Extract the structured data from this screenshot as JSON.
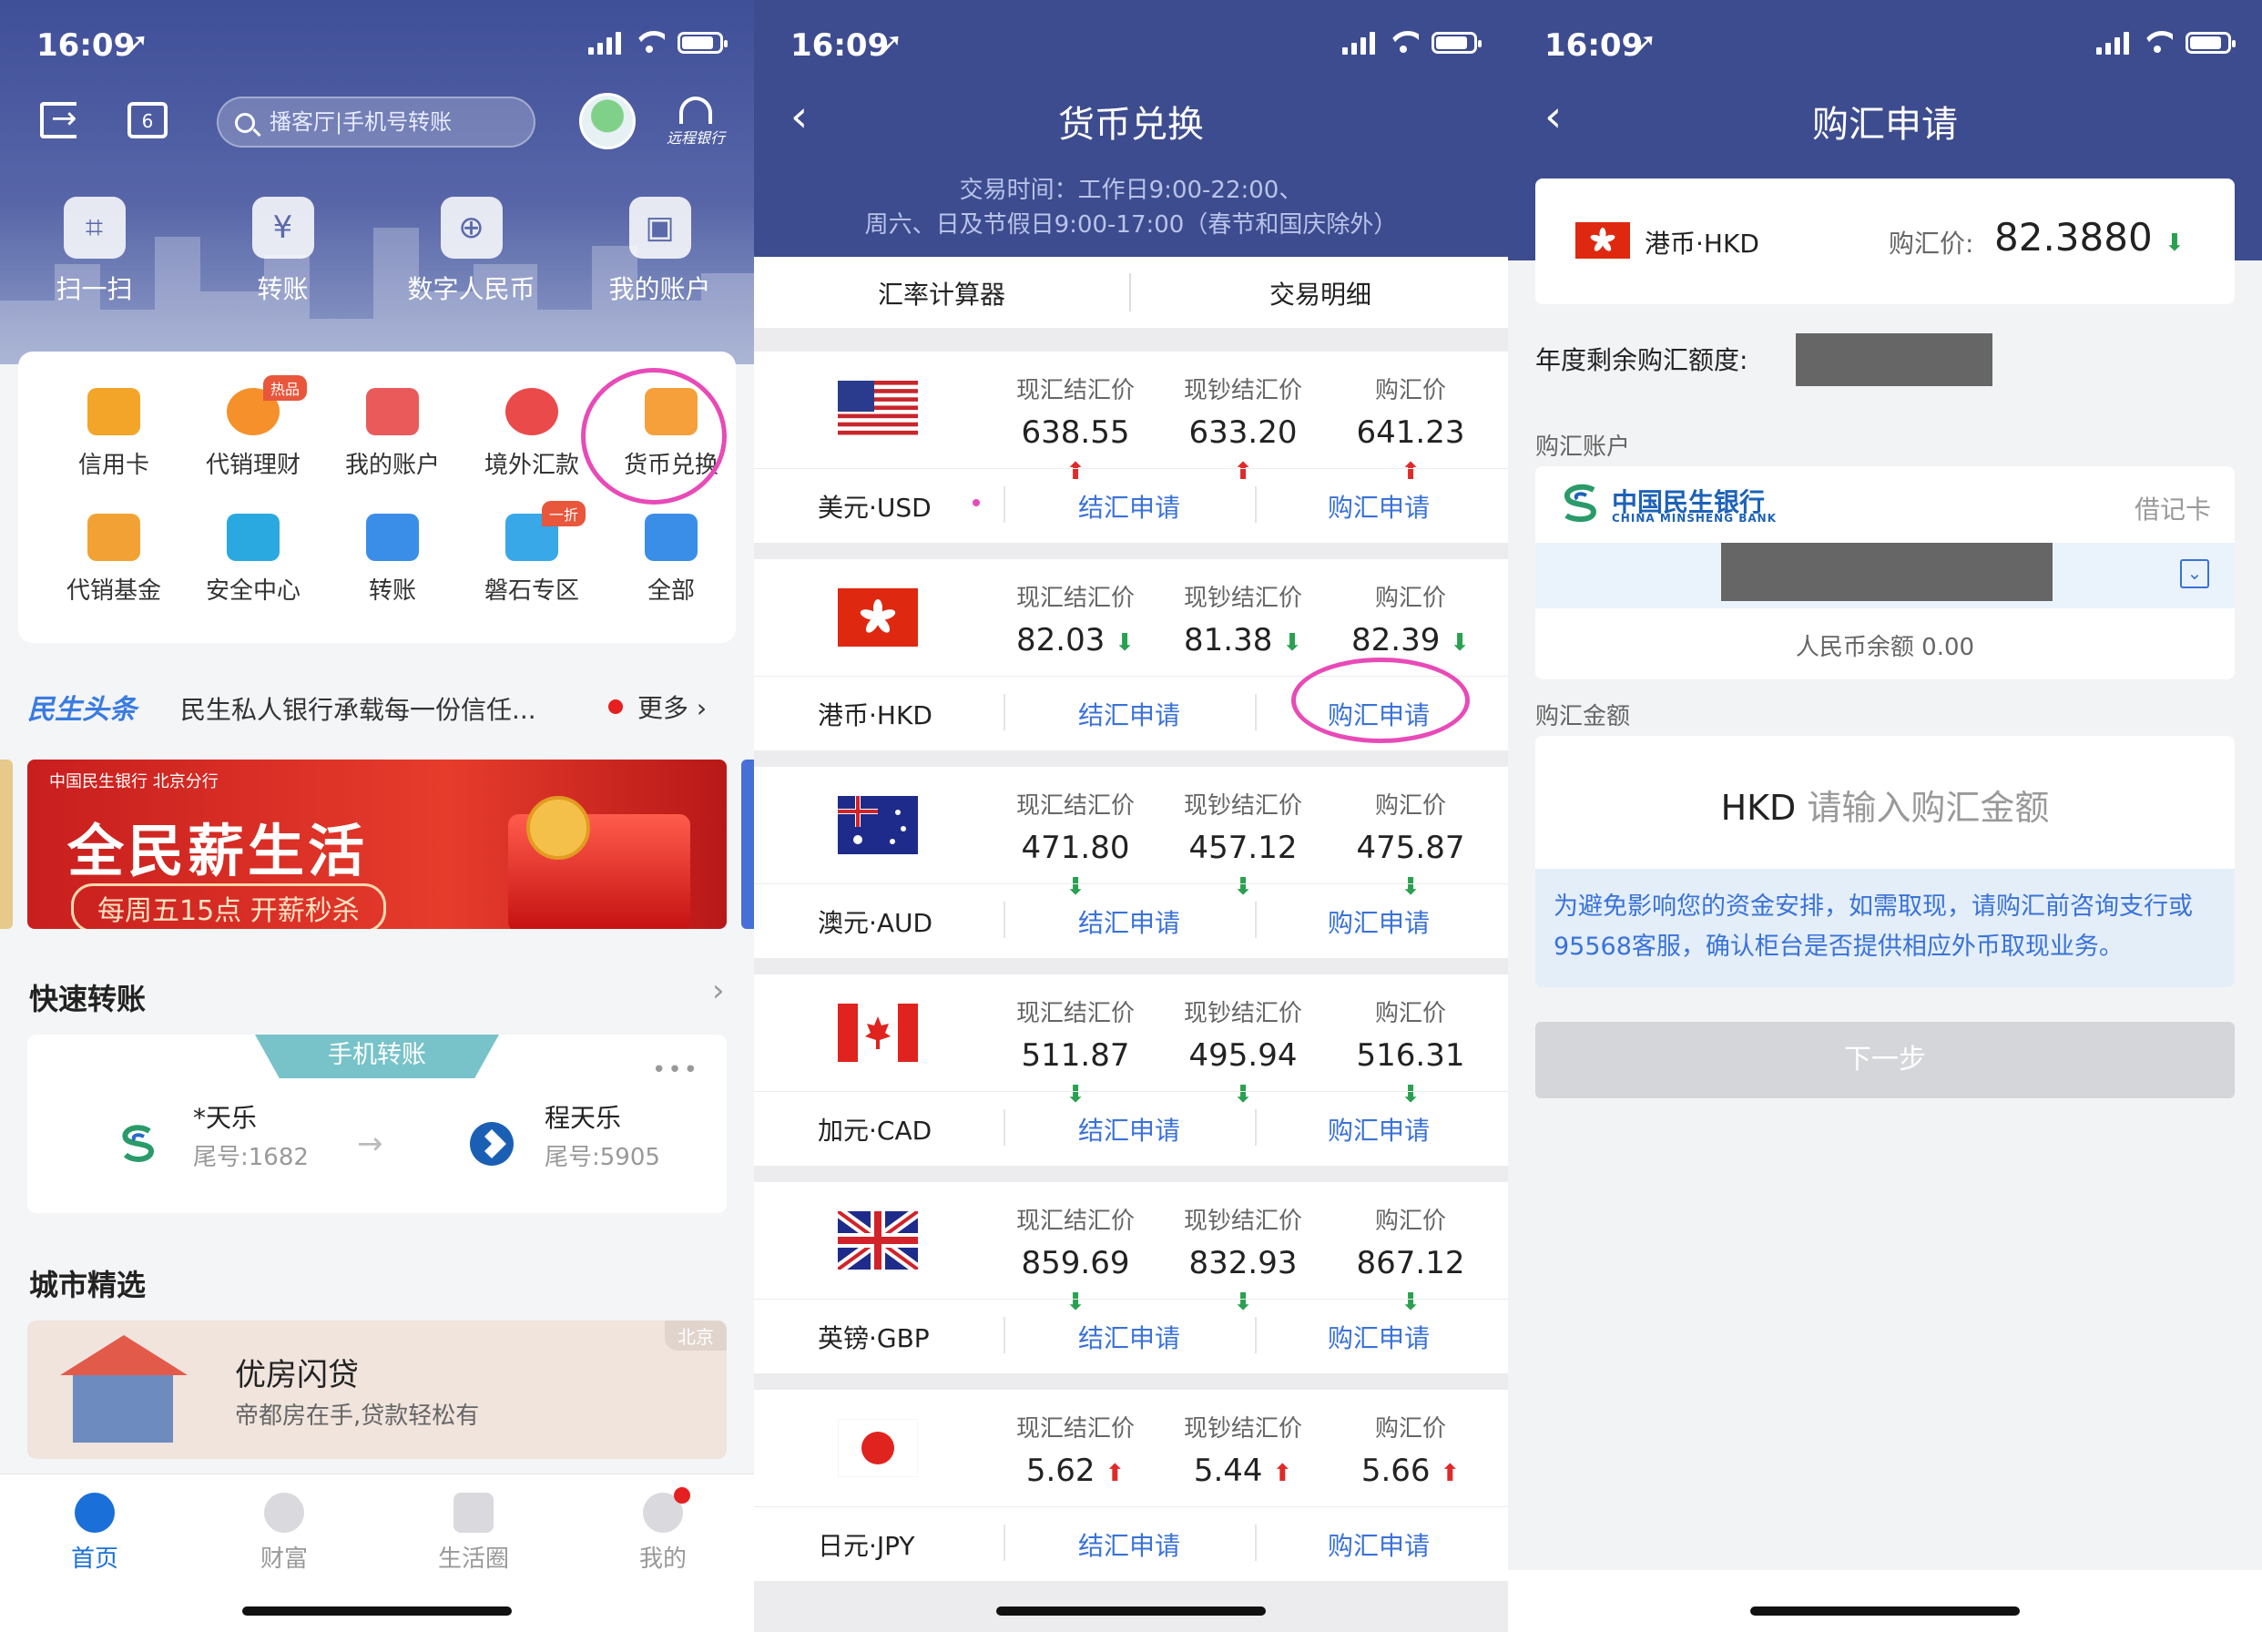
{
  "status": {
    "time": "16:09",
    "location_glyph": "➚"
  },
  "home": {
    "search_placeholder": "播客厅|手机号转账",
    "calendar_day": "6",
    "remote_label": "远程银行",
    "quick_actions": [
      "扫一扫",
      "转账",
      "数字人民币",
      "我的账户"
    ],
    "grid": [
      {
        "label": "信用卡",
        "tag": ""
      },
      {
        "label": "代销理财",
        "tag": "热品"
      },
      {
        "label": "我的账户",
        "tag": ""
      },
      {
        "label": "境外汇款",
        "tag": ""
      },
      {
        "label": "货币兑换",
        "tag": ""
      },
      {
        "label": "代销基金",
        "tag": ""
      },
      {
        "label": "安全中心",
        "tag": ""
      },
      {
        "label": "转账",
        "tag": ""
      },
      {
        "label": "磐石专区",
        "tag": "一折"
      },
      {
        "label": "全部",
        "tag": ""
      }
    ],
    "news": {
      "brand": "民生头条",
      "text": "民生私人银行承载每一份信任...",
      "more": "更多"
    },
    "banner": {
      "bank": "中国民生银行 北京分行",
      "headline": "全民薪生活",
      "sub": "每周五15点 开薪秒杀"
    },
    "quick_transfer": {
      "title": "快速转账",
      "ribbon": "手机转账",
      "from_name": "*天乐",
      "from_tail": "尾号:1682",
      "to_name": "程天乐",
      "to_tail": "尾号:5905"
    },
    "city": {
      "title": "城市精选",
      "loan_title": "优房闪贷",
      "loan_sub": "帝都房在手,贷款轻松有",
      "city_tag": "北京"
    },
    "tabs": [
      "首页",
      "财富",
      "生活圈",
      "我的"
    ]
  },
  "exchange": {
    "title": "货币兑换",
    "hours_line1": "交易时间：工作日9:00-22:00、",
    "hours_line2": "周六、日及节假日9:00-17:00（春节和国庆除外）",
    "subtabs": [
      "汇率计算器",
      "交易明细"
    ],
    "col_labels": [
      "现汇结汇价",
      "现钞结汇价",
      "购汇价"
    ],
    "sell_btn": "结汇申请",
    "buy_btn": "购汇申请",
    "rates": [
      {
        "name": "美元·USD",
        "flag": "us",
        "v1": "638.55",
        "d1": "up",
        "v2": "633.20",
        "d2": "up",
        "v3": "641.23",
        "d3": "up"
      },
      {
        "name": "港币·HKD",
        "flag": "hk",
        "v1": "82.03",
        "d1": "down",
        "v2": "81.38",
        "d2": "down",
        "v3": "82.39",
        "d3": "down"
      },
      {
        "name": "澳元·AUD",
        "flag": "au",
        "v1": "471.80",
        "d1": "down",
        "v2": "457.12",
        "d2": "down",
        "v3": "475.87",
        "d3": "down"
      },
      {
        "name": "加元·CAD",
        "flag": "ca",
        "v1": "511.87",
        "d1": "down",
        "v2": "495.94",
        "d2": "down",
        "v3": "516.31",
        "d3": "down"
      },
      {
        "name": "英镑·GBP",
        "flag": "gb",
        "v1": "859.69",
        "d1": "down",
        "v2": "832.93",
        "d2": "down",
        "v3": "867.12",
        "d3": "down"
      },
      {
        "name": "日元·JPY",
        "flag": "jp",
        "v1": "5.62",
        "d1": "up",
        "v2": "5.44",
        "d2": "up",
        "v3": "5.66",
        "d3": "up"
      }
    ]
  },
  "purchase": {
    "title": "购汇申请",
    "currency": "港币·HKD",
    "price_label": "购汇价:",
    "price": "82.3880",
    "quota_label": "年度剩余购汇额度:",
    "account_section": "购汇账户",
    "bank_name": "中国民生银行",
    "bank_name_en": "CHINA MINSHENG BANK",
    "card_type": "借记卡",
    "balance": "人民币余额   0.00",
    "amount_section": "购汇金额",
    "amount_code": "HKD",
    "amount_placeholder": "请输入购汇金额",
    "notice": "为避免影响您的资金安排，如需取现，请购汇前咨询支行或95568客服，确认柜台是否提供相应外币取现业务。",
    "next": "下一步"
  },
  "colors": {
    "brand_blue": "#3d4c8f",
    "link": "#3a72d8",
    "up": "#e02a2a",
    "down": "#2aa050",
    "highlight": "#e84ab8"
  }
}
